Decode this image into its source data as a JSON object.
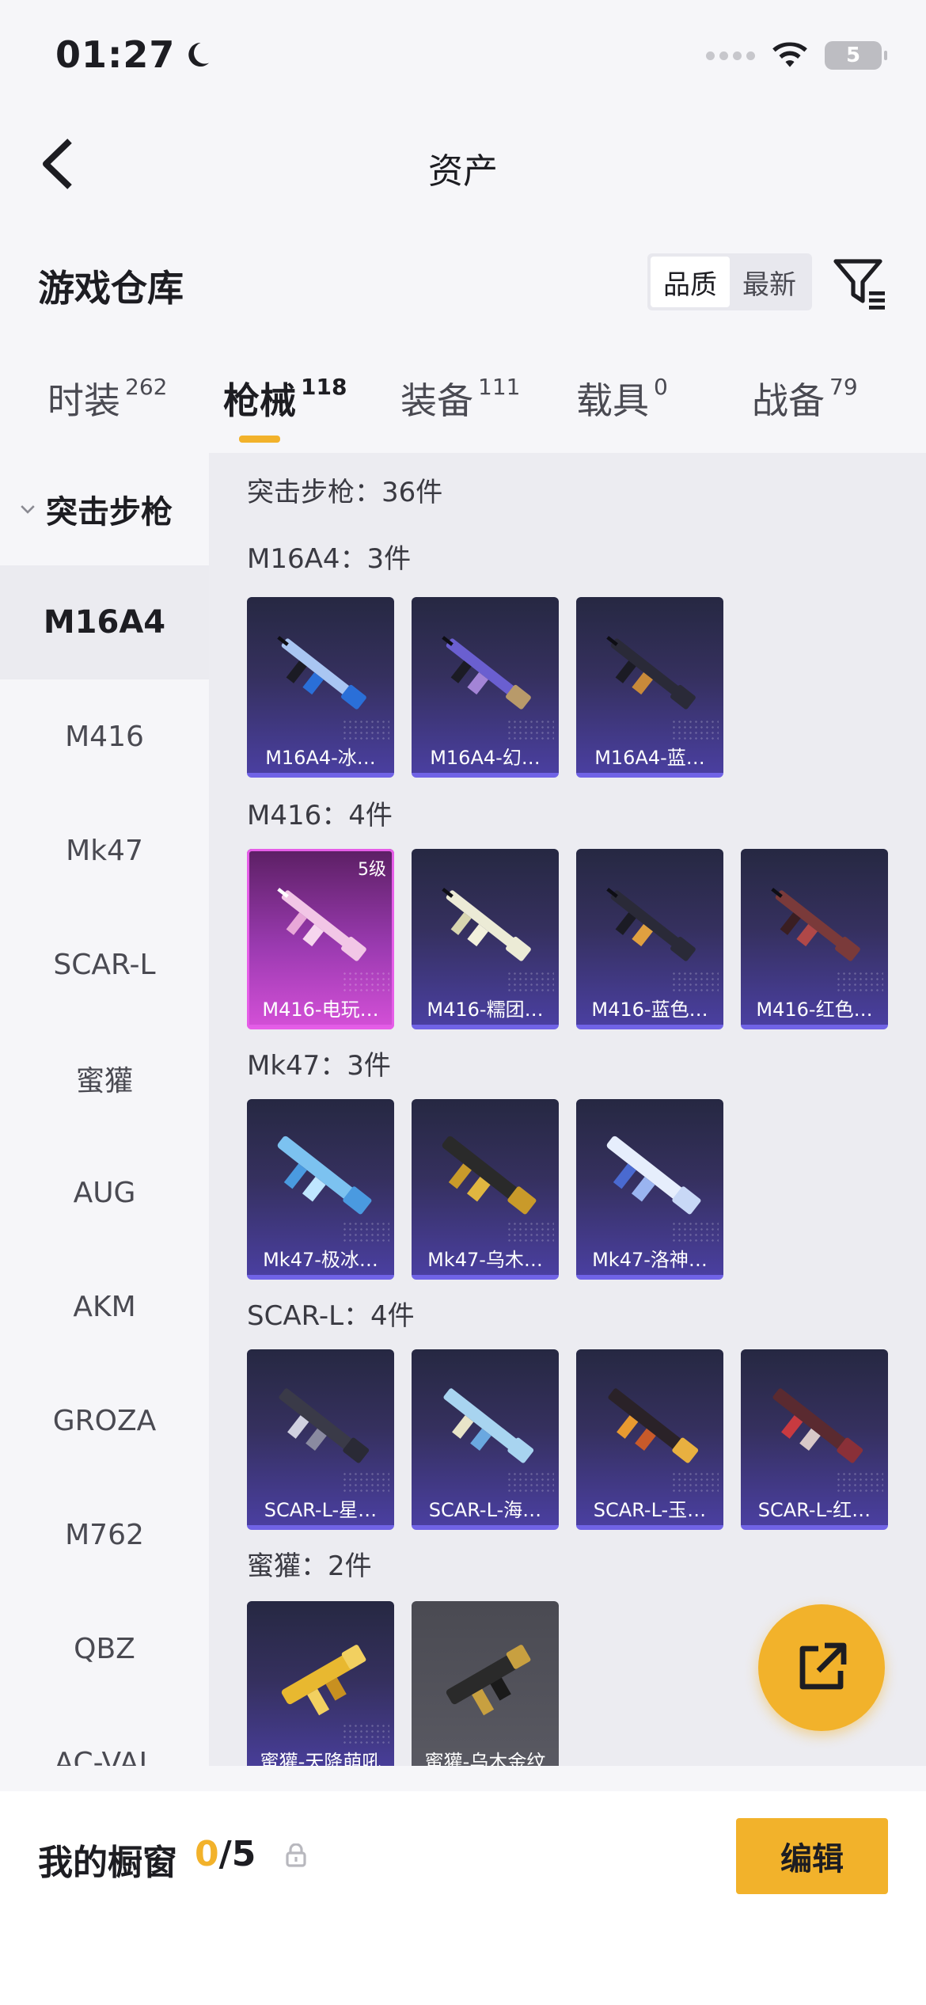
{
  "status_bar": {
    "time": "01:27",
    "battery": "5"
  },
  "nav": {
    "title": "资产"
  },
  "section": {
    "title": "游戏仓库"
  },
  "sort": {
    "options": [
      "品质",
      "最新"
    ],
    "active": "品质"
  },
  "tabs": [
    {
      "label": "时装",
      "count": "262"
    },
    {
      "label": "枪械",
      "count": "118"
    },
    {
      "label": "装备",
      "count": "111"
    },
    {
      "label": "载具",
      "count": "0"
    },
    {
      "label": "战备",
      "count": "79"
    }
  ],
  "sidebar": {
    "group": "突击步枪",
    "items": [
      "M16A4",
      "M416",
      "Mk47",
      "SCAR-L",
      "蜜獾",
      "AUG",
      "AKM",
      "GROZA",
      "M762",
      "QBZ",
      "AC-VAL"
    ]
  },
  "content": {
    "total": "突击步枪：36件",
    "groups": [
      {
        "title": "M16A4：3件",
        "items": [
          {
            "name": "M16A4-冰…"
          },
          {
            "name": "M16A4-幻…"
          },
          {
            "name": "M16A4-蓝…"
          }
        ]
      },
      {
        "title": "M416：4件",
        "items": [
          {
            "name": "M416-电玩…",
            "level": "5级"
          },
          {
            "name": "M416-糯团…"
          },
          {
            "name": "M416-蓝色…"
          },
          {
            "name": "M416-红色…"
          }
        ]
      },
      {
        "title": "Mk47：3件",
        "items": [
          {
            "name": "Mk47-极冰…"
          },
          {
            "name": "Mk47-乌木…"
          },
          {
            "name": "Mk47-洛神…"
          }
        ]
      },
      {
        "title": "SCAR-L：4件",
        "items": [
          {
            "name": "SCAR-L-星…"
          },
          {
            "name": "SCAR-L-海…"
          },
          {
            "name": "SCAR-L-玉…"
          },
          {
            "name": "SCAR-L-红…"
          }
        ]
      },
      {
        "title": "蜜獾：2件",
        "items": [
          {
            "name": "蜜獾-天降萌吼"
          },
          {
            "name": "蜜獾-乌木金纹"
          }
        ]
      }
    ]
  },
  "bottom": {
    "label": "我的橱窗",
    "current": "0",
    "max": "/5",
    "edit": "编辑"
  },
  "colors": {
    "accent": "#f2b22b",
    "purple_rarity": "#7063e6",
    "pink_rarity": "#e65de8"
  }
}
